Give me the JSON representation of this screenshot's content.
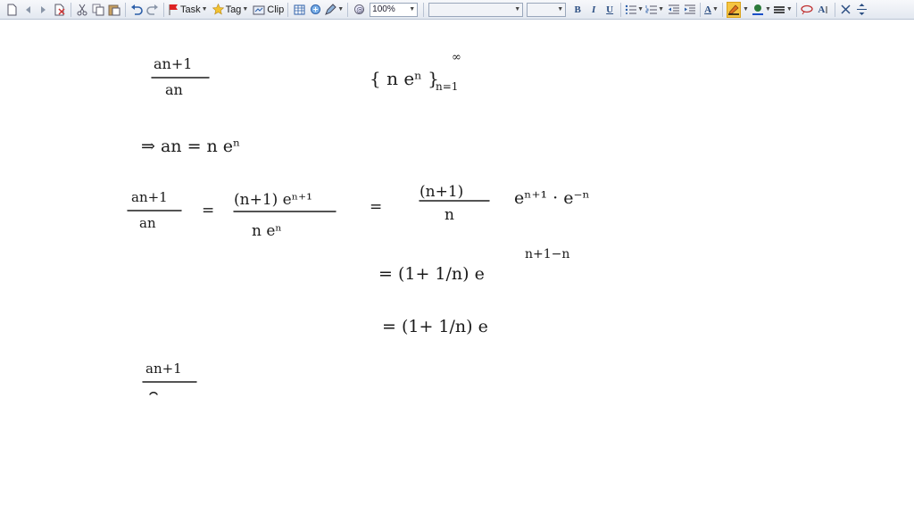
{
  "toolbar": {
    "task_label": "Task",
    "tag_label": "Tag",
    "clip_label": "Clip",
    "zoom_value": "100%",
    "font_name": "",
    "font_size": "",
    "bold_label": "B",
    "italic_label": "I",
    "underline_label": "U",
    "font_color_label": "A",
    "text_style_label": "A",
    "accent_color": "#f5c542"
  },
  "notes": {
    "line1_num": "an+1",
    "line1_den": "an",
    "set_expr": "{ n eⁿ }",
    "set_sup": "∞",
    "set_sub": "n=1",
    "line2": "⇒ an = n eⁿ",
    "line3_lhs_num": "an+1",
    "line3_lhs_den": "an",
    "line3_mid_num": "(n+1) eⁿ⁺¹",
    "line3_mid_den": "n eⁿ",
    "line3_rhs_num": "(n+1)",
    "line3_rhs_den": "n",
    "line3_rhs_exp": "eⁿ⁺¹ · e⁻ⁿ",
    "line4": "= (1+ 1/n) e",
    "line4_sup": "n+1−n",
    "line5": "= (1+ 1/n) e",
    "line6_num": "an+1"
  }
}
